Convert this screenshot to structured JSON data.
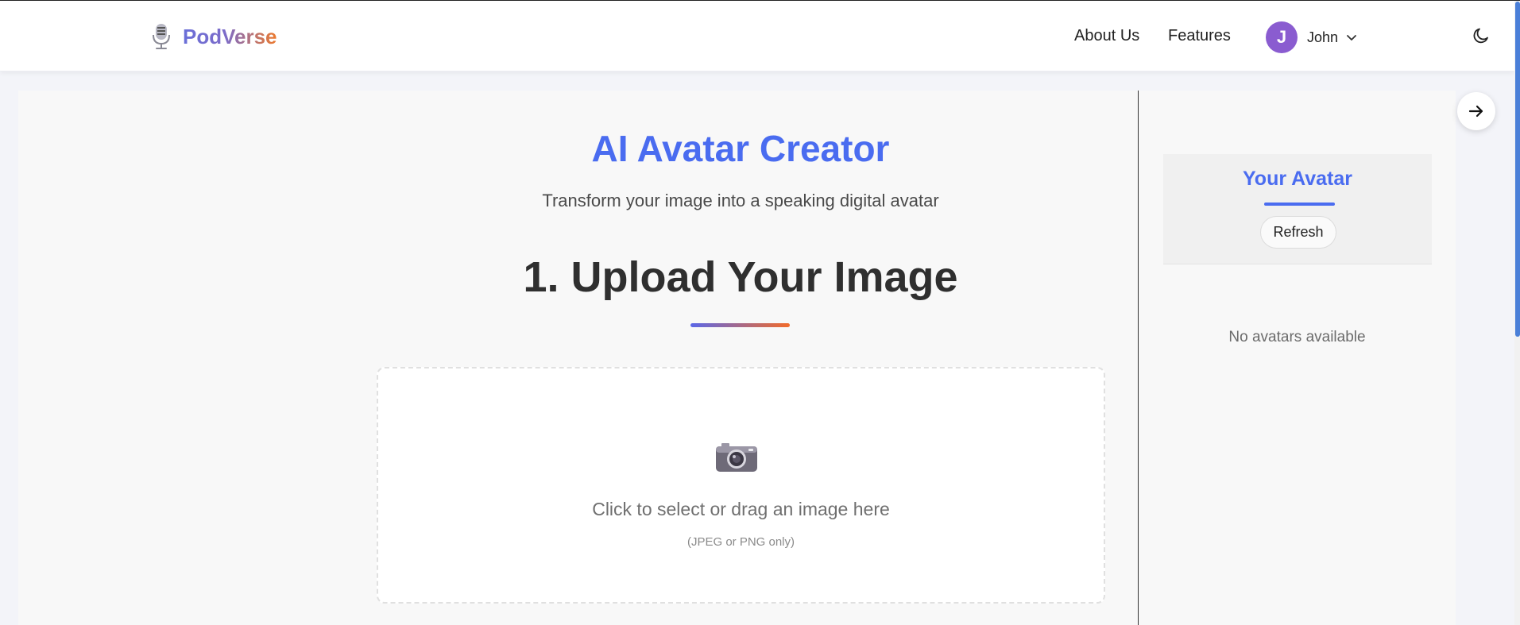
{
  "header": {
    "brand": "PodVerse",
    "nav": {
      "about": "About Us",
      "features": "Features"
    },
    "user": {
      "initial": "J",
      "name": "John"
    }
  },
  "main": {
    "title": "AI Avatar Creator",
    "subtitle": "Transform your image into a speaking digital avatar",
    "step_title": "1. Upload Your Image",
    "dropzone": {
      "text": "Click to select or drag an image here",
      "hint": "(JPEG or PNG only)"
    }
  },
  "sidebar": {
    "title": "Your Avatar",
    "refresh_label": "Refresh",
    "empty_message": "No avatars available"
  },
  "colors": {
    "accent": "#4a6cf0",
    "brand_gradient_start": "#6a6fd8",
    "brand_gradient_end": "#ee7a2c",
    "avatar_bg": "#8a5cd0"
  },
  "icons": [
    "microphone-icon",
    "chevron-down-icon",
    "moon-icon",
    "camera-icon",
    "arrow-right-icon"
  ]
}
